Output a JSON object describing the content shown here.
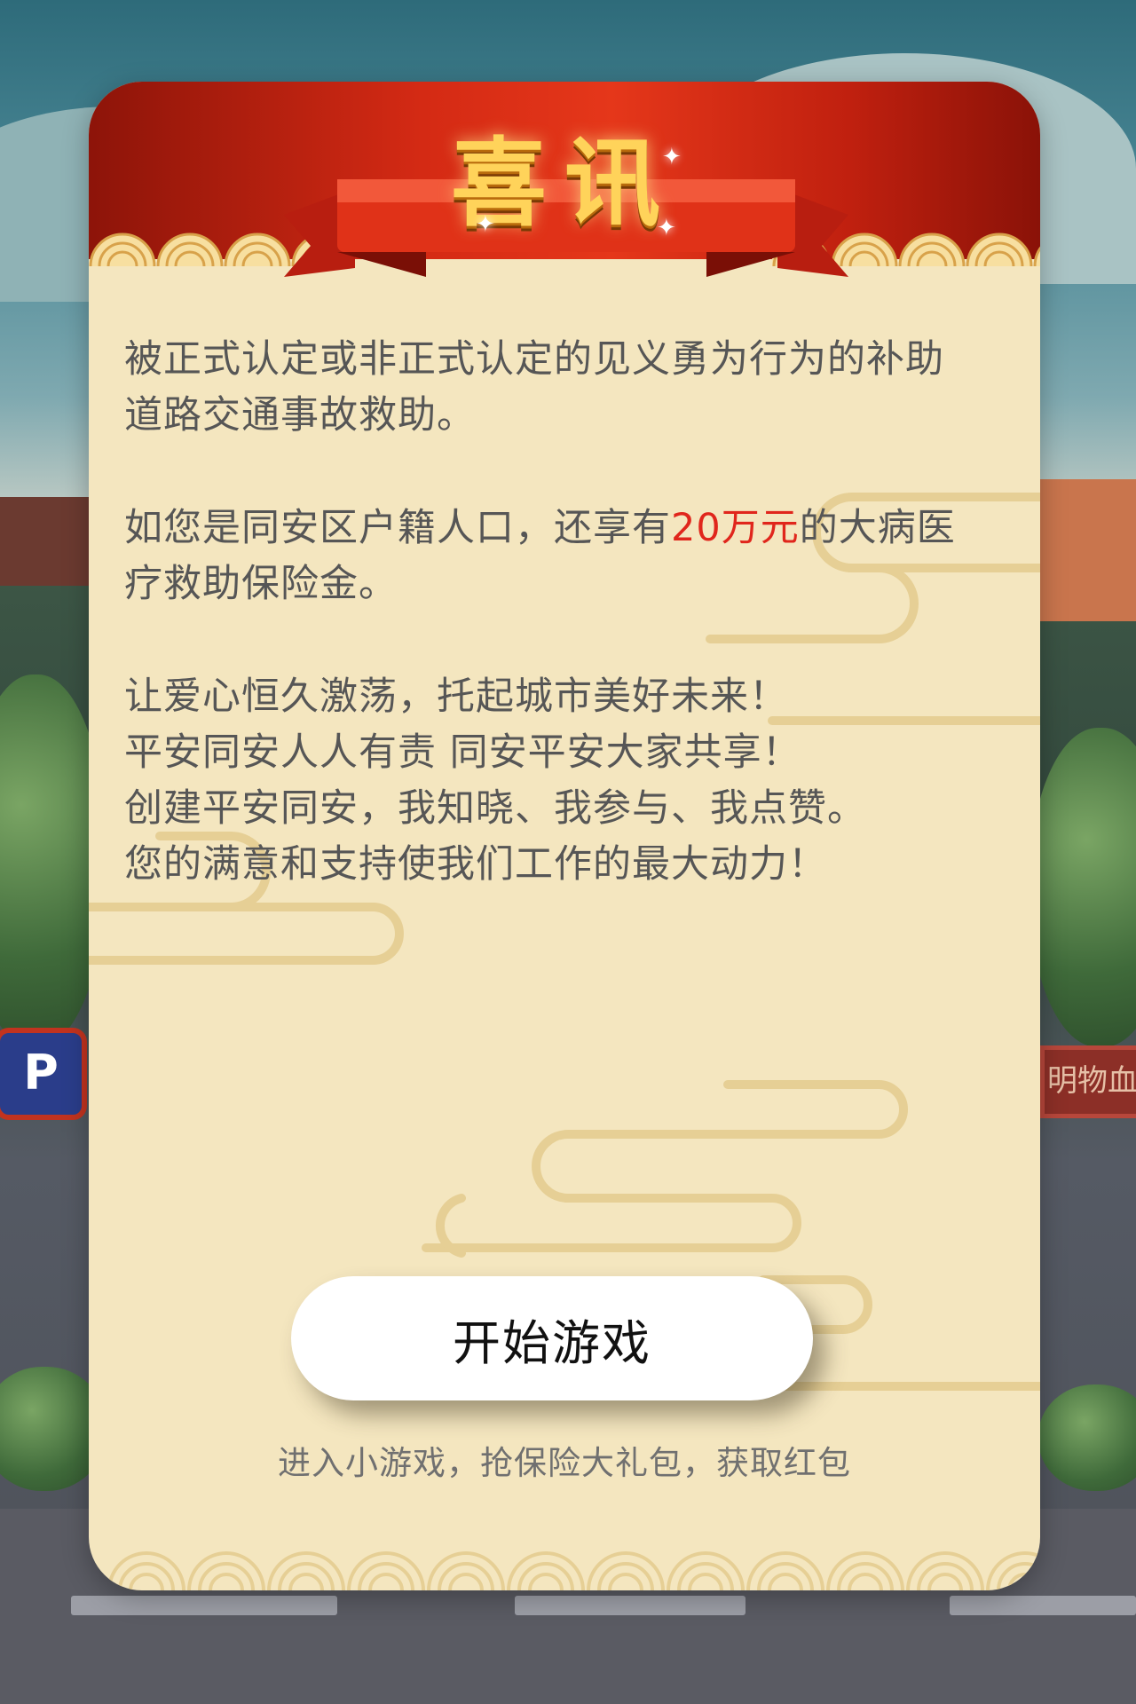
{
  "banner": {
    "title": "喜讯"
  },
  "paragraphs": {
    "p1": {
      "line1": "被正式认定或非正式认定的见义勇为行为的补助",
      "line2": "道路交通事故救助。"
    },
    "p2": {
      "line1_before": "如您是同安区户籍人口，还享有",
      "line1_highlight": "20万元",
      "line1_after": "的大病医",
      "line2": "疗救助保险金。"
    },
    "p3": {
      "line1": "让爱心恒久激荡，托起城市美好未来！",
      "line2": "平安同安人人有责 同安平安大家共享！",
      "line3": "创建平安同安，我知晓、我参与、我点赞。",
      "line4": "您的满意和支持使我们工作的最大动力！"
    }
  },
  "start_button": {
    "label": "开始游戏"
  },
  "hint": {
    "text": "进入小游戏，抢保险大礼包，获取红包"
  },
  "background": {
    "parking_sign": "P",
    "right_sign": "明物血"
  },
  "colors": {
    "banner_red": "#d42a14",
    "card_bg": "#f4e6bf",
    "highlight": "#e0261c",
    "title_gold": "#ffd35a"
  }
}
